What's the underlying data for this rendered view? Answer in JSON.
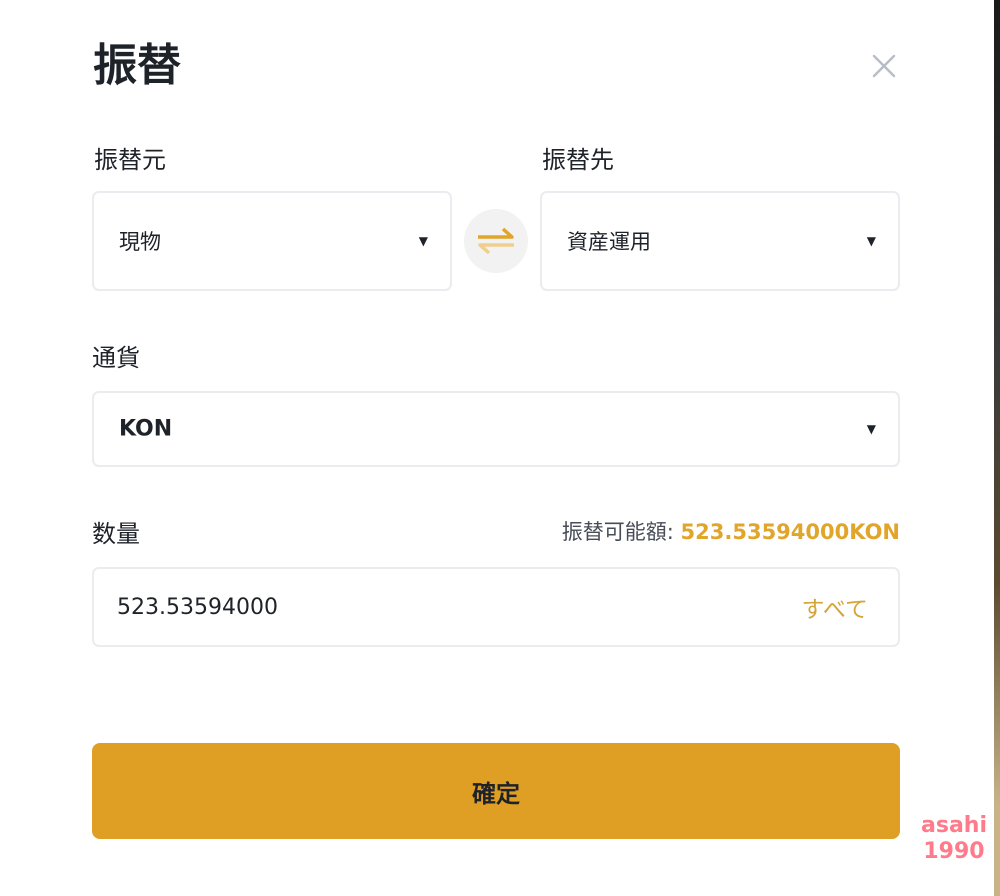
{
  "dialog": {
    "title": "振替",
    "close_icon": "close-icon"
  },
  "from": {
    "label": "振替元",
    "value": "現物"
  },
  "to": {
    "label": "振替先",
    "value": "資産運用"
  },
  "swap_icon": "swap-arrows-icon",
  "currency": {
    "label": "通貨",
    "value": "KON"
  },
  "amount": {
    "label": "数量",
    "available_label": "振替可能額:",
    "available_value": "523.53594000KON",
    "value": "523.53594000",
    "max_label": "すべて"
  },
  "confirm_label": "確定",
  "watermark": {
    "line1": "asahi",
    "line2": "1990"
  },
  "colors": {
    "accent": "#df9f25",
    "accent_text": "#e1a52a",
    "border": "#eaecef"
  }
}
